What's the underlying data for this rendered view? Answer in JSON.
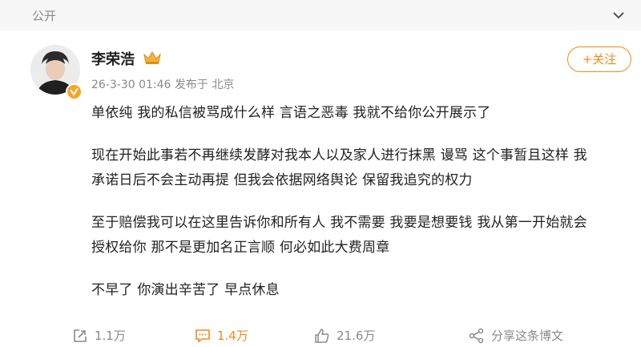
{
  "header": {
    "label": "公开"
  },
  "user": {
    "name": "李荣浩",
    "meta": "26-3-30 01:46 发布于 北京"
  },
  "follow_label": "+关注",
  "paragraphs": [
    {
      "lines": [
        "单依纯 我的私信被骂成什么样 言语之恶毒 我就不给你公开展示了"
      ]
    },
    {
      "lines": [
        "现在开始此事若不再继续发酵对我本人以及家人进行抹黑 谩骂 这个事暂且这样 我",
        "承诺日后不会主动再提 但我会依据网络舆论 保留我追究的权力"
      ]
    },
    {
      "lines": [
        "至于赔偿我可以在这里告诉你和所有人 我不需要 我要是想要钱 我从第一开始就会",
        "授权给你 那不是更加名正言顺 何必如此大费周章"
      ]
    },
    {
      "lines": [
        "不早了 你演出辛苦了 早点休息"
      ]
    }
  ],
  "actions": {
    "repost": "1.1万",
    "comment": "1.4万",
    "like": "21.6万",
    "share": "分享这条博文"
  },
  "colors": {
    "accent": "#f08a1b",
    "muted": "#8a8a8a",
    "badge": "#f5a623"
  },
  "icons": [
    "chevron-down-icon",
    "verified-badge-icon",
    "crown-icon",
    "repost-icon",
    "comment-icon",
    "like-icon",
    "share-icon"
  ]
}
